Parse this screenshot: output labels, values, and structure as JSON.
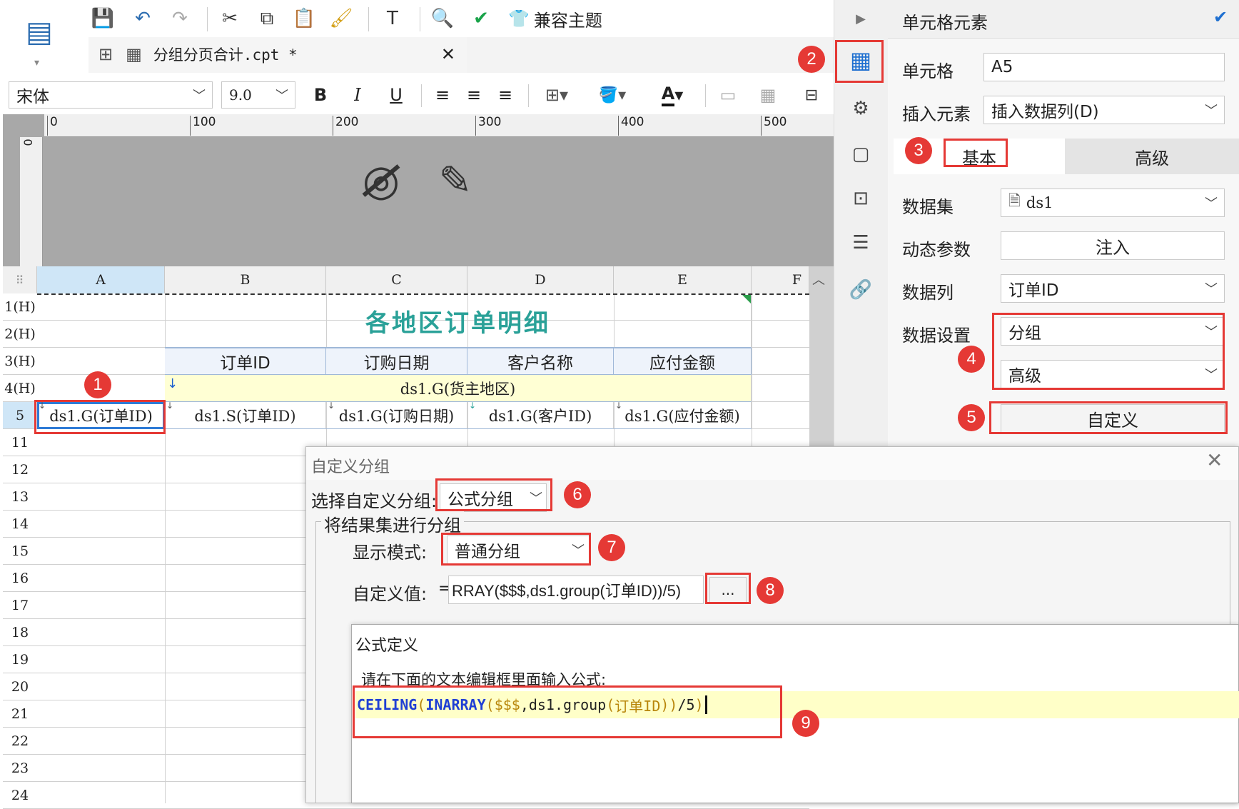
{
  "toolbar": {
    "compat_theme": "兼容主题",
    "tab_title": "分组分页合计.cpt *",
    "font_name": "宋体",
    "font_size": "9.0"
  },
  "sheet": {
    "columns": [
      "A",
      "B",
      "C",
      "D",
      "E",
      "F"
    ],
    "ruler_ticks": [
      "0",
      "100",
      "200",
      "300",
      "400",
      "500"
    ],
    "ruler_v": "0",
    "rows": [
      "1(H)",
      "2(H)",
      "3(H)",
      "4(H)",
      "5",
      "11",
      "12",
      "13",
      "14",
      "15",
      "16",
      "17",
      "18",
      "19",
      "20",
      "21",
      "22",
      "23",
      "24"
    ],
    "title": "各地区订单明细",
    "headers": [
      "订单ID",
      "订购日期",
      "客户名称",
      "应付金额"
    ],
    "group_cell": "ds1.G(货主地区)",
    "row5": [
      "ds1.G(订单ID)",
      "ds1.S(订单ID)",
      "ds1.G(订购日期)",
      "ds1.G(客户ID)",
      "ds1.G(应付金额)"
    ]
  },
  "panel": {
    "title": "单元格元素",
    "cell_label": "单元格",
    "cell_value": "A5",
    "insert_label": "插入元素",
    "insert_value": "插入数据列(D)",
    "tab_basic": "基本",
    "tab_adv": "高级",
    "dataset_label": "数据集",
    "dataset_value": "ds1",
    "param_label": "动态参数",
    "param_button": "注入",
    "column_label": "数据列",
    "column_value": "订单ID",
    "setting_label": "数据设置",
    "setting_value1": "分组",
    "setting_value2": "高级",
    "custom_button": "自定义"
  },
  "dialog": {
    "title": "自定义分组",
    "choose_label": "选择自定义分组:",
    "choose_value": "公式分组",
    "group_legend": "将结果集进行分组",
    "display_label": "显示模式:",
    "display_value": "普通分组",
    "custom_label": "自定义值:",
    "eq": "=",
    "custom_value": "RRAY($$$,ds1.group(订单ID))/5)",
    "more_button": "..."
  },
  "formula": {
    "title": "公式定义",
    "hint": "请在下面的文本编辑框里面输入公式:",
    "code_fn1": "CEILING",
    "code_p1": "(",
    "code_fn2": "INARRAY",
    "code_p2": "(",
    "code_arg": "$$$",
    "code_rest": ",ds1.group",
    "code_p3": "(",
    "code_field": "订单ID",
    "code_p4": "))",
    "code_div": "/5",
    "code_p5": ")"
  },
  "badges": [
    "1",
    "2",
    "3",
    "4",
    "5",
    "6",
    "7",
    "8",
    "9"
  ],
  "colors": {
    "accent": "#2b6cb0",
    "title_teal": "#2aa198",
    "marker": "#e53935",
    "formula_highlight": "#ffffc8"
  }
}
